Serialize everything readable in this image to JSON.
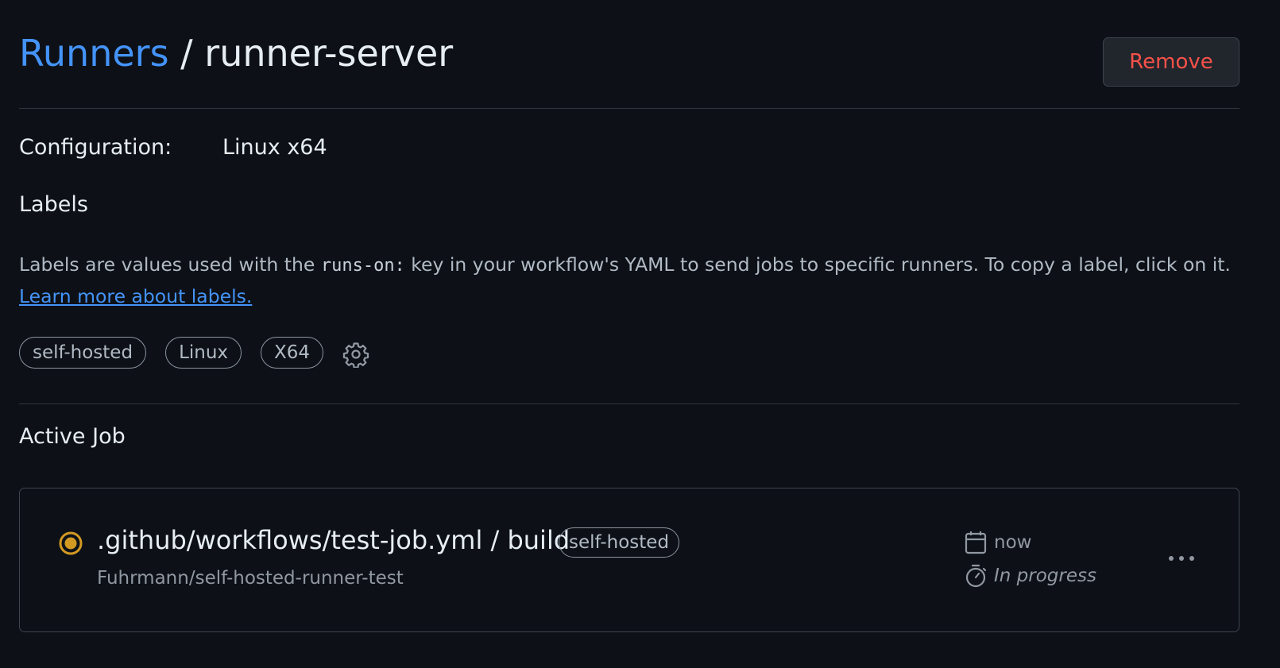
{
  "header": {
    "breadcrumb_link": "Runners",
    "separator": " / ",
    "runner_name": "runner-server",
    "remove_label": "Remove"
  },
  "configuration": {
    "label": "Configuration:",
    "value": "Linux x64"
  },
  "labels_section": {
    "heading": "Labels",
    "desc_before": "Labels are values used with the ",
    "desc_code": "runs-on:",
    "desc_after": " key in your workflow's YAML to send jobs to specific runners. To copy a label, click on it. ",
    "learn_more": "Learn more about labels.",
    "labels": [
      "self-hosted",
      "Linux",
      "X64"
    ],
    "settings_icon": "gear-icon"
  },
  "active_job": {
    "heading": "Active Job",
    "title": ".github/workflows/test-job.yml / build",
    "tag": "self-hosted",
    "repo": "Fuhrmann/self-hosted-runner-test",
    "when": "now",
    "status": "In progress",
    "status_color": "#d29922",
    "icons": [
      "calendar-icon",
      "stopwatch-icon",
      "kebab-icon"
    ]
  },
  "colors": {
    "background": "#0d1117",
    "link": "#4493f8",
    "danger": "#f85149",
    "border": "#30363d"
  }
}
